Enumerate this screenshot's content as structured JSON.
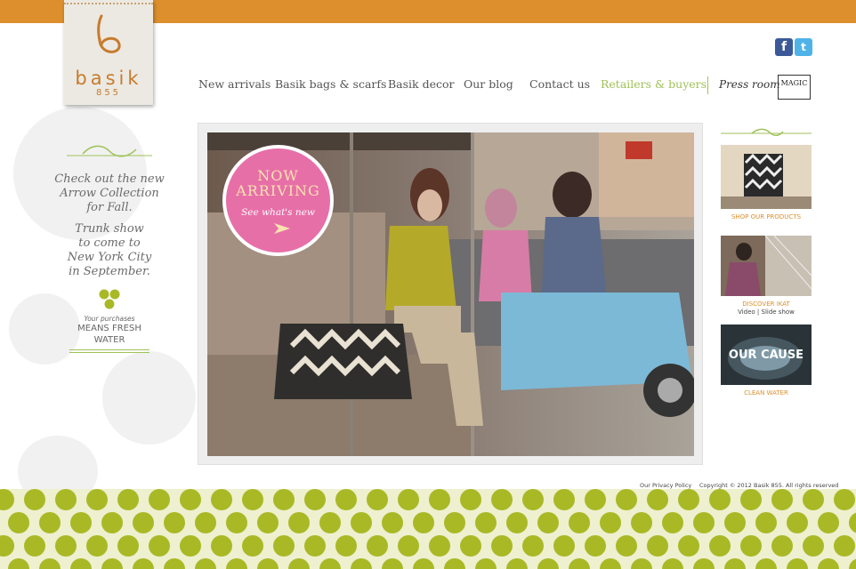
{
  "brand": {
    "name": "basik",
    "number": "855",
    "accent_color": "#dc8f2c",
    "green_color": "#9fc257"
  },
  "social": [
    {
      "icon": "facebook-icon",
      "glyph": "f"
    },
    {
      "icon": "twitter-icon",
      "glyph": "t"
    }
  ],
  "nav": {
    "items": [
      "New arrivals",
      "Basik bags & scarfs",
      "Basik decor",
      "Our blog",
      "Contact us",
      "Retailers & buyers"
    ],
    "press_room": "Press room",
    "magic_logo": "MAGIC"
  },
  "sidebar": {
    "promo": [
      "Check out the new",
      "Arrow Collection",
      "for Fall."
    ],
    "trunk": [
      "Trunk show",
      "to come to",
      "New York  City",
      "in September."
    ],
    "purchases": "Your purchases",
    "means": [
      "MEANS FRESH",
      "WATER"
    ]
  },
  "hero": {
    "badge_title": [
      "NOW",
      "ARRIVING"
    ],
    "badge_link": "See what's new"
  },
  "right": [
    {
      "caption": "SHOP OUR PRODUCTS",
      "sub": ""
    },
    {
      "caption": "DISCOVER IKAT",
      "sub": "Video | Slide show",
      "overlay": ""
    },
    {
      "caption": "CLEAN WATER",
      "sub": "",
      "overlay": "OUR CAUSE"
    }
  ],
  "footer": {
    "privacy": "Our Privacy Policy",
    "copyright": "Copyright © 2012 Basik 855. All rights reserved"
  }
}
